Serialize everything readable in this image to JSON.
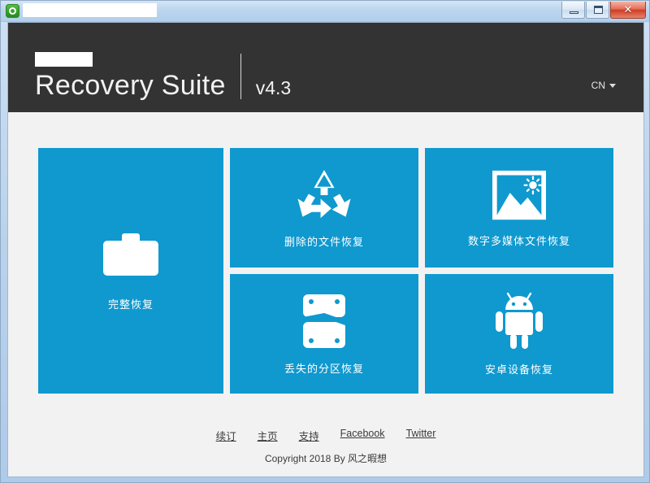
{
  "titlebar": {
    "app_icon": "recovery-app-icon",
    "title_text": "",
    "buttons": {
      "minimize": "minimize-icon",
      "maximize": "maximize-icon",
      "close": "✕"
    }
  },
  "header": {
    "brand_title": "Recovery Suite",
    "version": "v4.3",
    "language": "CN",
    "caret": "chevron-down-icon",
    "background_color": "#333333"
  },
  "tiles": {
    "accent_color": "#0f99cf",
    "items": [
      {
        "id": "full-recovery",
        "label": "完整恢复",
        "icon": "folder-icon"
      },
      {
        "id": "deleted-file",
        "label": "删除的文件恢复",
        "icon": "recycle-icon"
      },
      {
        "id": "digital-media",
        "label": "数字多媒体文件恢复",
        "icon": "photo-icon"
      },
      {
        "id": "lost-partition",
        "label": "丢失的分区恢复",
        "icon": "broken-disk-icon"
      },
      {
        "id": "android-device",
        "label": "安卓设备恢复",
        "icon": "android-icon"
      }
    ]
  },
  "footer": {
    "links": [
      {
        "label": "续订"
      },
      {
        "label": "主页"
      },
      {
        "label": "支持"
      },
      {
        "label": "Facebook"
      },
      {
        "label": "Twitter"
      }
    ],
    "copyright": "Copyright 2018 By 风之暇想"
  }
}
